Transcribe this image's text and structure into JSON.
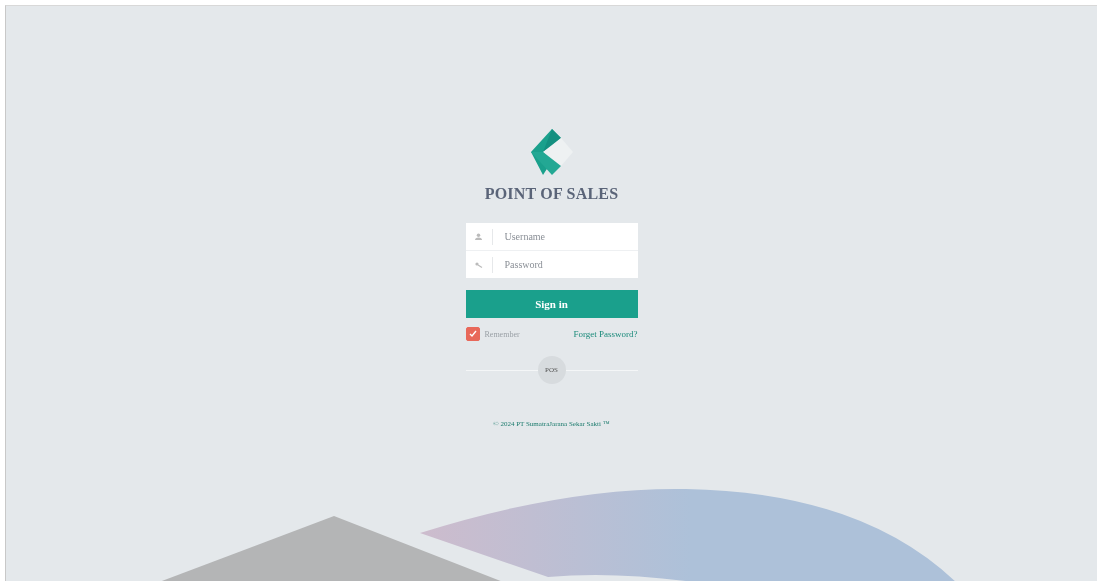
{
  "title": "POINT OF SALES",
  "fields": [
    {
      "kind": "user",
      "placeholder": "Username"
    },
    {
      "kind": "key",
      "placeholder": "Password"
    }
  ],
  "sign_in": "Sign in",
  "remember": {
    "label": "Remember",
    "checked": true
  },
  "forgot": "Forget Password?",
  "divider_badge": "POS",
  "footer": "© 2024 PT SumatraJarana Sekar Sakti ™"
}
